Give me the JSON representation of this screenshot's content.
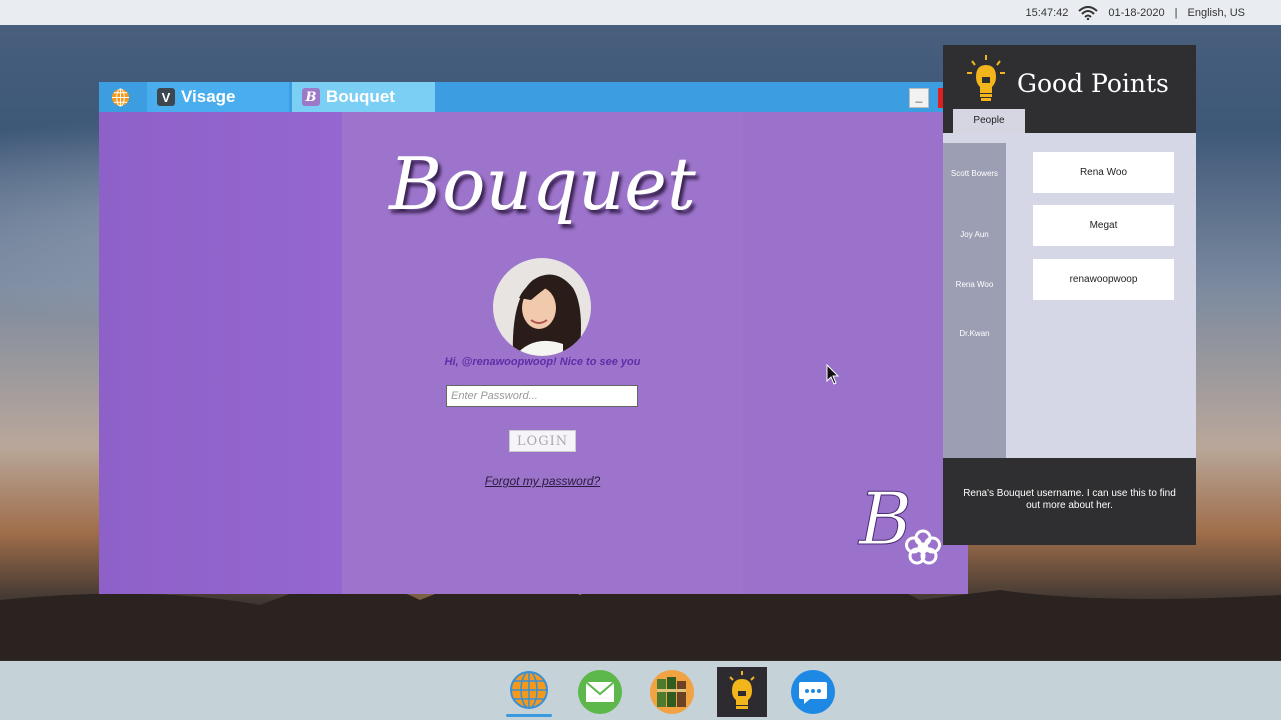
{
  "status_bar": {
    "time": "15:47:42",
    "date": "01-18-2020",
    "separator": "|",
    "locale": "English, US"
  },
  "browser": {
    "tabs": [
      {
        "label": "Visage",
        "icon_letter": "V"
      },
      {
        "label": "Bouquet",
        "icon_letter": "B"
      }
    ],
    "minimize_symbol": "_"
  },
  "bouquet": {
    "title": "Bouquet",
    "greeting": "Hi, @renawoopwoop! Nice to see you",
    "password_placeholder": "Enter Password...",
    "login_label": "LOGIN",
    "forgot_label": "Forgot my password?",
    "logo_letter": "B"
  },
  "good_points": {
    "title": "Good Points",
    "tab_label": "People",
    "people": [
      "Scott Bowers",
      "Joy Aun",
      "Rena Woo",
      "Dr.Kwan"
    ],
    "cards": [
      "Rena Woo",
      "Megat",
      "renawoopwoop"
    ],
    "note": "Rena's Bouquet username. I can use this to find out more about her."
  },
  "dock": {
    "items": [
      "globe-browser-icon",
      "mail-icon",
      "books-icon",
      "good-points-bulb-icon",
      "chat-icon"
    ]
  },
  "colors": {
    "bouquet_purple": "#9d74cb",
    "tab_blue": "#3c9ee0",
    "panel_dark": "#2f2f31"
  }
}
